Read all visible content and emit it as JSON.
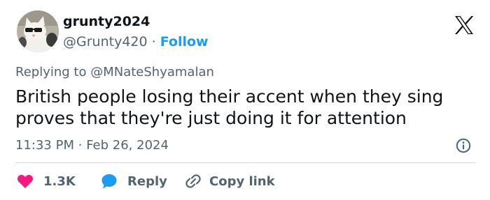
{
  "user": {
    "display_name": "grunty2024",
    "handle": "@Grunty420",
    "separator": "·",
    "follow_label": "Follow"
  },
  "tweet": {
    "replying_prefix": "Replying to ",
    "replying_to": "@MNateShyamalan",
    "text": "British people losing their accent when they sing proves that they're just doing it for attention",
    "time": "11:33 PM",
    "date_separator": "·",
    "date": "Feb 26, 2024"
  },
  "actions": {
    "like_count": "1.3K",
    "reply_label": "Reply",
    "copy_link_label": "Copy link"
  },
  "colors": {
    "accent": "#1d9bf0",
    "like": "#f91880",
    "text": "#0f1419",
    "secondary": "#536471",
    "divider": "#cfd9de"
  },
  "icons": {
    "brand": "x-logo-icon",
    "info": "info-icon",
    "like": "heart-icon",
    "reply": "speech-bubble-icon",
    "copy": "link-icon"
  }
}
